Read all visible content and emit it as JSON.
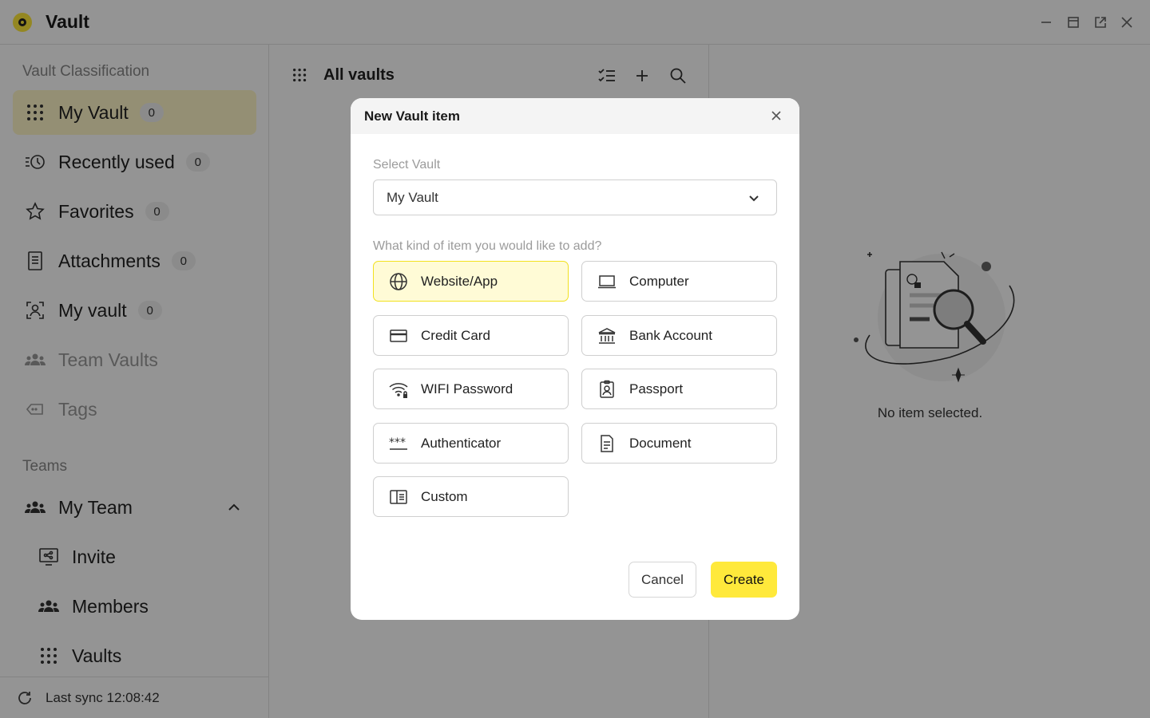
{
  "app": {
    "title": "Vault"
  },
  "sidebar": {
    "heading_classification": "Vault Classification",
    "items": [
      {
        "label": "My Vault",
        "count": "0"
      },
      {
        "label": "Recently used",
        "count": "0"
      },
      {
        "label": "Favorites",
        "count": "0"
      },
      {
        "label": "Attachments",
        "count": "0"
      },
      {
        "label": "My vault",
        "count": "0"
      },
      {
        "label": "Team Vaults"
      },
      {
        "label": "Tags"
      }
    ],
    "heading_teams": "Teams",
    "team": {
      "label": "My Team"
    },
    "team_items": [
      {
        "label": "Invite"
      },
      {
        "label": "Members"
      },
      {
        "label": "Vaults"
      }
    ],
    "sync": "Last sync 12:08:42"
  },
  "list": {
    "title": "All vaults"
  },
  "detail": {
    "empty_text": "No item selected."
  },
  "modal": {
    "title": "New Vault item",
    "select_label": "Select Vault",
    "select_value": "My Vault",
    "kind_label": "What kind of item you would like to add?",
    "types": [
      {
        "label": "Website/App",
        "icon": "globe-icon"
      },
      {
        "label": "Computer",
        "icon": "laptop-icon"
      },
      {
        "label": "Credit Card",
        "icon": "credit-card-icon"
      },
      {
        "label": "Bank Account",
        "icon": "bank-icon"
      },
      {
        "label": "WIFI Password",
        "icon": "wifi-lock-icon"
      },
      {
        "label": "Passport",
        "icon": "passport-icon"
      },
      {
        "label": "Authenticator",
        "icon": "password-dots-icon"
      },
      {
        "label": "Document",
        "icon": "document-icon"
      },
      {
        "label": "Custom",
        "icon": "custom-icon"
      }
    ],
    "cancel": "Cancel",
    "create": "Create"
  },
  "colors": {
    "accent": "#ffe93b",
    "selected_bg": "#fffbd6",
    "active_nav": "#fff7c9"
  }
}
